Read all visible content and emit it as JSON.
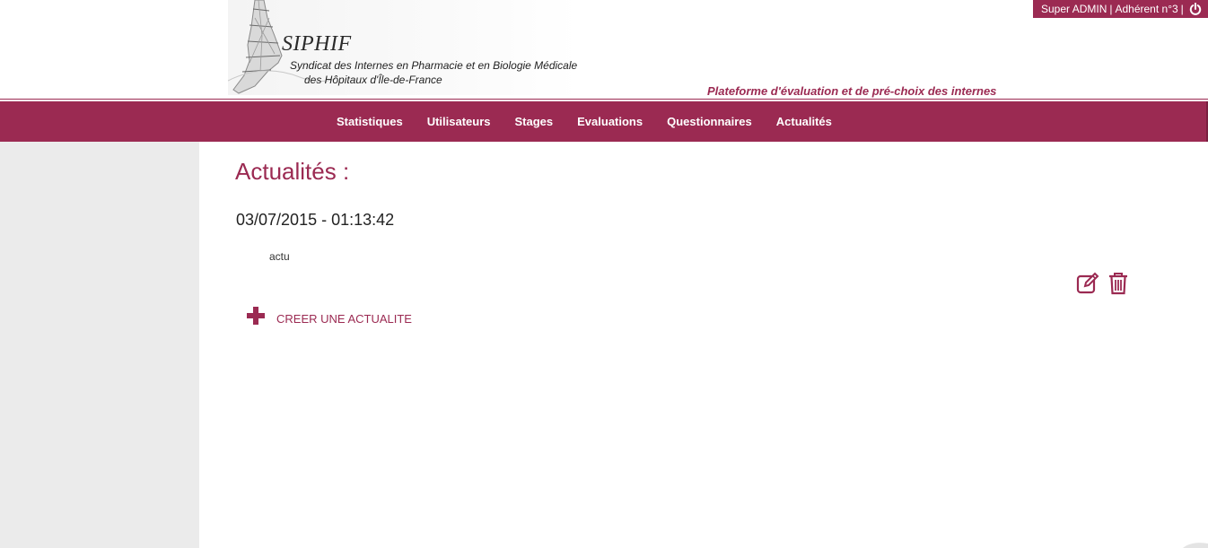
{
  "header": {
    "logo": {
      "name": "SIPHIF",
      "line1": "Syndicat des Internes en Pharmacie et en Biologie Médicale",
      "line2": "des Hôpitaux d'Île-de-France"
    },
    "tagline": "Plateforme d'évaluation et de pré-choix des internes",
    "user": {
      "role": "Super ADMIN",
      "separator": "|",
      "member": "Adhérent n°3",
      "trailing_separator": "|",
      "logout_icon": "power-icon"
    }
  },
  "nav": {
    "items": [
      {
        "label": "Statistiques"
      },
      {
        "label": "Utilisateurs"
      },
      {
        "label": "Stages"
      },
      {
        "label": "Evaluations"
      },
      {
        "label": "Questionnaires"
      },
      {
        "label": "Actualités"
      }
    ]
  },
  "main": {
    "title": "Actualités :",
    "news": [
      {
        "date": "03/07/2015 - 01:13:42",
        "body": "actu",
        "edit_icon": "edit-icon",
        "delete_icon": "trash-icon"
      }
    ],
    "create_label": "CREER UNE ACTUALITE",
    "create_icon": "plus-icon"
  },
  "colors": {
    "brand": "#9b2a52",
    "sidebar": "#ebebeb",
    "text": "#222222"
  }
}
